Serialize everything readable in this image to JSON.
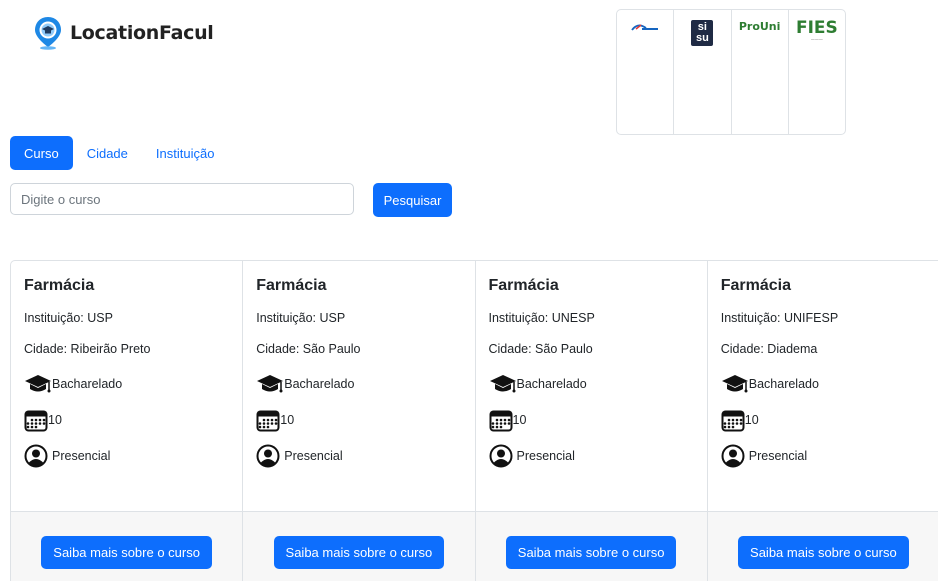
{
  "header": {
    "app_title": "LocationFacul"
  },
  "partners": {
    "enem": "ENEM",
    "sisu_top": "si",
    "sisu_bottom": "su",
    "prouni": "ProUni",
    "fies": "FIES"
  },
  "tabs": [
    {
      "label": "Curso",
      "active": true
    },
    {
      "label": "Cidade",
      "active": false
    },
    {
      "label": "Instituição",
      "active": false
    }
  ],
  "search": {
    "placeholder": "Digite o curso",
    "value": "",
    "button_label": "Pesquisar"
  },
  "cards": [
    {
      "title": "Farmácia",
      "institution": "Instituição: USP",
      "city": "Cidade: Ribeirão Preto",
      "degree": "Bacharelado",
      "duration": "10",
      "modality": "Presencial",
      "button_label": "Saiba mais sobre o curso"
    },
    {
      "title": "Farmácia",
      "institution": "Instituição: USP",
      "city": "Cidade: São Paulo",
      "degree": "Bacharelado",
      "duration": "10",
      "modality": "Presencial",
      "button_label": "Saiba mais sobre o curso"
    },
    {
      "title": "Farmácia",
      "institution": "Instituição: UNESP",
      "city": "Cidade: São Paulo",
      "degree": "Bacharelado",
      "duration": "10",
      "modality": "Presencial",
      "button_label": "Saiba mais sobre o curso"
    },
    {
      "title": "Farmácia",
      "institution": "Instituição: UNIFESP",
      "city": "Cidade: Diadema",
      "degree": "Bacharelado",
      "duration": "10",
      "modality": "Presencial",
      "button_label": "Saiba mais sobre o curso"
    }
  ],
  "colors": {
    "primary": "#0d6efd",
    "border": "#dee2e6",
    "footer_bg": "#f7f7f7"
  }
}
